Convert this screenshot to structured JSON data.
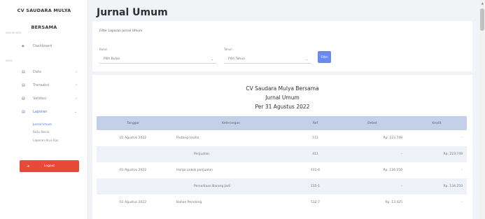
{
  "sidebar": {
    "brand_line1": "CV SAUDARA MULYA",
    "brand_line2": "BERSAMA",
    "section_dashboard": "DASHBOARD",
    "dashboard_label": "Dashboard",
    "section_menu": "MENU",
    "items": [
      {
        "label": "Data"
      },
      {
        "label": "Transaksi"
      },
      {
        "label": "Validasi"
      },
      {
        "label": "Laporan"
      }
    ],
    "sub_items": [
      {
        "label": "Jurnal Umum"
      },
      {
        "label": "Buku Besar"
      },
      {
        "label": "Laporan Arus Kas"
      }
    ],
    "logout_label": "Logout"
  },
  "header": {
    "title": "Jurnal Umum"
  },
  "filter": {
    "title": "Filter Laporan Jurnal Umum",
    "bulan_label": "Bulan",
    "bulan_value": "Pilih Bulan",
    "tahun_label": "Tahun",
    "tahun_value": "Pilih Tahun",
    "button_label": "Filter"
  },
  "report": {
    "company": "CV Saudara Mulya Bersama",
    "title": "Jurnal Umum",
    "period": "Per 31 Agustus 2022",
    "columns": [
      "Tanggal",
      "Keterangan",
      "Ref",
      "Debet",
      "Kredit"
    ],
    "rows": [
      {
        "tanggal": "01 Agustus 2022",
        "keterangan": "Piutang Usaha",
        "ref": "113",
        "debet": "Rp. 223.749",
        "kredit": "-"
      },
      {
        "tanggal": "",
        "keterangan": "Penjualan",
        "ref": "411",
        "debet": "-",
        "kredit": "Rp. 223.749"
      },
      {
        "tanggal": "01 Agustus 2022",
        "keterangan": "Harga pokok penjualan",
        "ref": "411-4",
        "debet": "Rp. 134.250",
        "kredit": "-"
      },
      {
        "tanggal": "",
        "keterangan": "Persediaan Barang Jadi",
        "ref": "115-1",
        "debet": "-",
        "kredit": "Rp. 134.250"
      },
      {
        "tanggal": "01 Agustus 2022",
        "keterangan": "Bahan Penolong",
        "ref": "512-7",
        "debet": "Rp. 13.425",
        "kredit": "-"
      }
    ]
  },
  "colors": {
    "primary": "#4e73df",
    "danger": "#e74a3b",
    "table_header": "#c3d1e8"
  }
}
